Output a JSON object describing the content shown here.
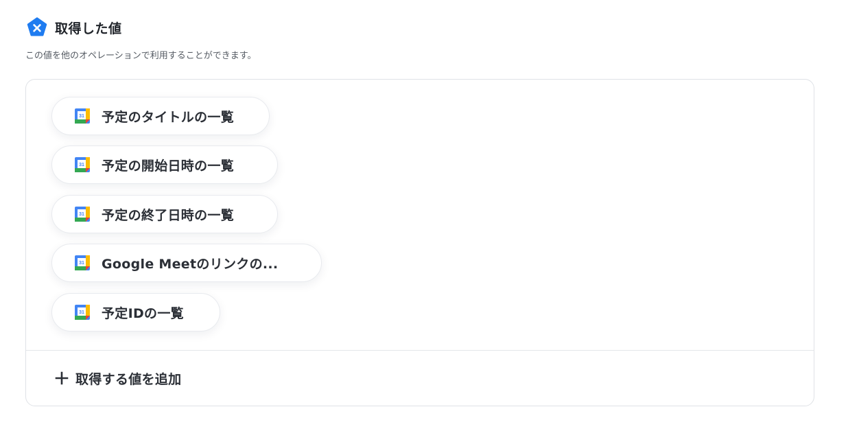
{
  "header": {
    "title": "取得した値",
    "icon": "yoom-x-pentagon-icon",
    "icon_color": "#1f7cf0"
  },
  "subtitle": "この値を他のオペレーションで利用することができます。",
  "values": {
    "items": [
      {
        "label": "予定のタイトルの一覧",
        "icon": "google-calendar-icon"
      },
      {
        "label": "予定の開始日時の一覧",
        "icon": "google-calendar-icon"
      },
      {
        "label": "予定の終了日時の一覧",
        "icon": "google-calendar-icon"
      },
      {
        "label": "Google Meetのリンクの...",
        "icon": "google-calendar-icon"
      },
      {
        "label": "予定IDの一覧",
        "icon": "google-calendar-icon"
      }
    ]
  },
  "add_button": {
    "label": "取得する値を追加",
    "icon": "plus-icon"
  }
}
